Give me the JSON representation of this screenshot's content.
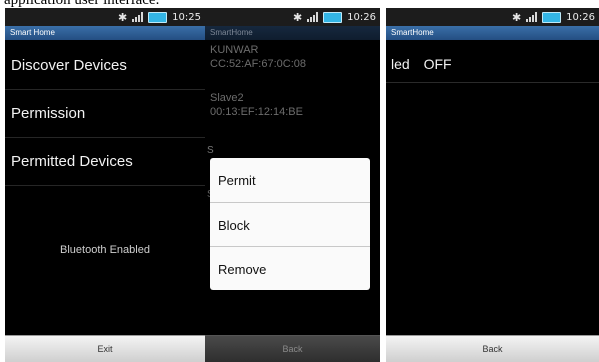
{
  "caption": "application user interface.",
  "screens": [
    {
      "time": "10:25",
      "title": "Smart Home",
      "menu": [
        "Discover Devices",
        "Permission",
        "Permitted Devices"
      ],
      "status": "Bluetooth Enabled",
      "button": "Exit"
    },
    {
      "time": "10:26",
      "title": "SmartHome",
      "devices": [
        {
          "name": "KUNWAR",
          "address": "CC:52:AF:67:0C:08"
        },
        {
          "name": "Slave2",
          "address": "00:13:EF:12:14:BE"
        }
      ],
      "dialog_options": [
        "Permit",
        "Block",
        "Remove"
      ],
      "button": "Back"
    },
    {
      "time": "10:26",
      "title": "SmartHome",
      "device_name": "led",
      "device_state": "OFF",
      "button": "Back"
    }
  ],
  "colors": {
    "titlebar": "#2f5f97",
    "battery": "#33b5e5"
  }
}
